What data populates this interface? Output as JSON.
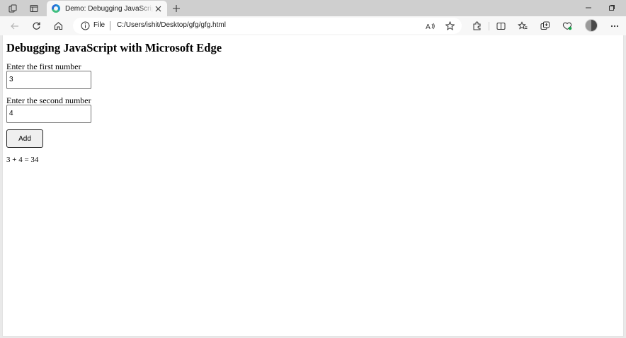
{
  "browser": {
    "tab": {
      "title": "Demo: Debugging JavaScript with Microsoft Edge"
    },
    "address_bar": {
      "scheme_label": "File",
      "url": "C:/Users/ishit/Desktop/gfg/gfg.html"
    },
    "icons": [
      "workspaces-icon",
      "tab-actions-icon",
      "edge-favicon-icon",
      "close-icon",
      "plus-icon",
      "minimize-icon",
      "restore-icon",
      "back-icon",
      "refresh-icon",
      "home-icon",
      "info-icon",
      "read-aloud-icon",
      "favorite-star-icon",
      "extensions-icon",
      "split-screen-icon",
      "favorites-icon",
      "collections-icon",
      "browser-essentials-icon",
      "avatar",
      "more-icon"
    ]
  },
  "page": {
    "heading": "Debugging JavaScript with Microsoft Edge",
    "first_label": "Enter the first number",
    "first_value": "3",
    "second_label": "Enter the second number",
    "second_value": "4",
    "add_button": "Add",
    "result": "3 + 4 = 34"
  }
}
